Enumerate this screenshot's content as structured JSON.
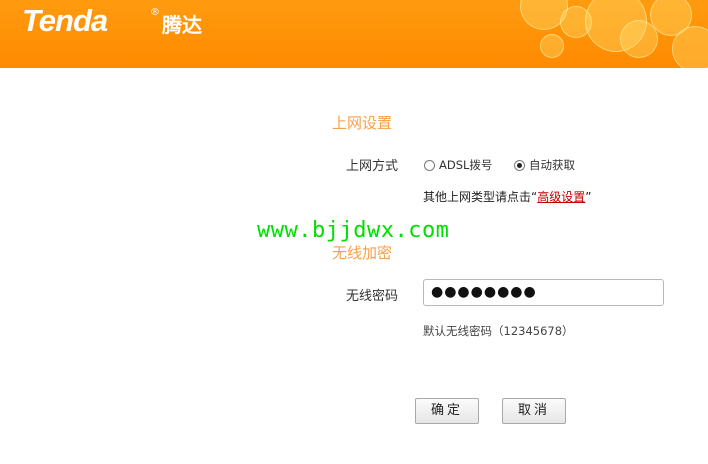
{
  "header": {
    "brand": "Tenda",
    "registered_mark": "®",
    "brand_cn": "腾达",
    "bg_color": "#ff8a00"
  },
  "internet": {
    "section_title": "上网设置",
    "mode_label": "上网方式",
    "options": [
      {
        "label": "ADSL拨号",
        "checked": false
      },
      {
        "label": "自动获取",
        "checked": true
      }
    ],
    "hint_prefix": "其他上网类型请点击",
    "hint_link": "高级设置"
  },
  "wireless": {
    "section_title": "无线加密",
    "password_label": "无线密码",
    "password_value": "●●●●●●●●",
    "default_hint": "默认无线密码（12345678）"
  },
  "actions": {
    "confirm": "确定",
    "cancel": "取消"
  },
  "watermark": "www.bjjdwx.com"
}
